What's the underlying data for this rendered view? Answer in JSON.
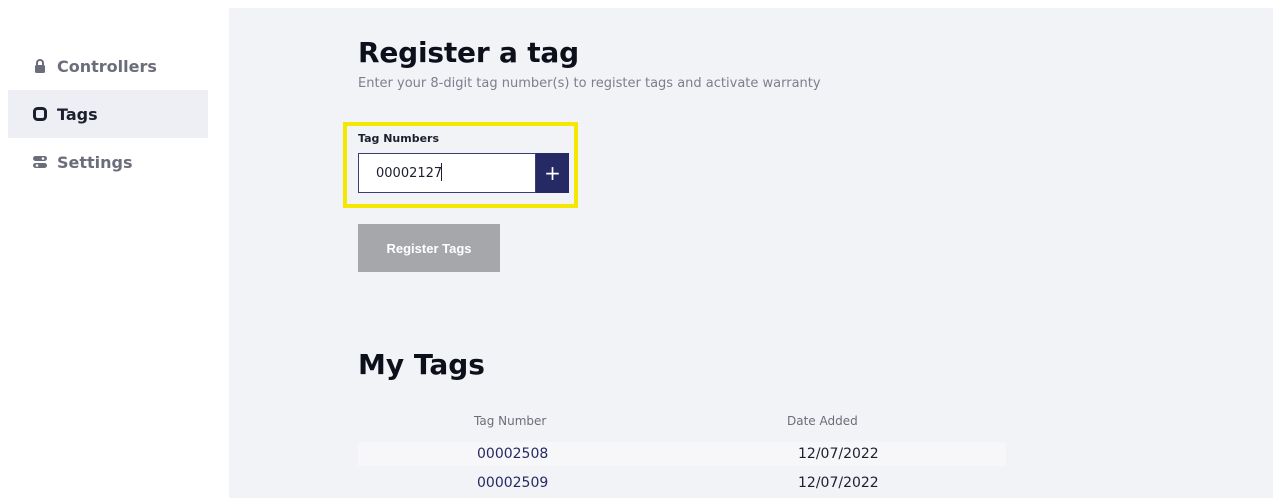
{
  "sidebar": {
    "items": [
      {
        "label": "Controllers",
        "icon": "lock-icon",
        "active": false
      },
      {
        "label": "Tags",
        "icon": "tag-icon",
        "active": true
      },
      {
        "label": "Settings",
        "icon": "sliders-icon",
        "active": false
      }
    ]
  },
  "register": {
    "title": "Register a tag",
    "subtitle": "Enter your 8-digit tag number(s) to register tags and activate warranty",
    "field_label": "Tag Numbers",
    "input_value": "00002127",
    "add_icon": "+",
    "button_label": "Register Tags"
  },
  "my_tags": {
    "title": "My Tags",
    "columns": [
      "Tag Number",
      "Date Added"
    ],
    "rows": [
      {
        "tag_number": "00002508",
        "date_added": "12/07/2022"
      },
      {
        "tag_number": "00002509",
        "date_added": "12/07/2022"
      }
    ]
  },
  "colors": {
    "accent": "#262a64",
    "highlight": "#f5e800",
    "button_disabled": "#a6a7ab",
    "page_bg": "#f2f3f7"
  }
}
